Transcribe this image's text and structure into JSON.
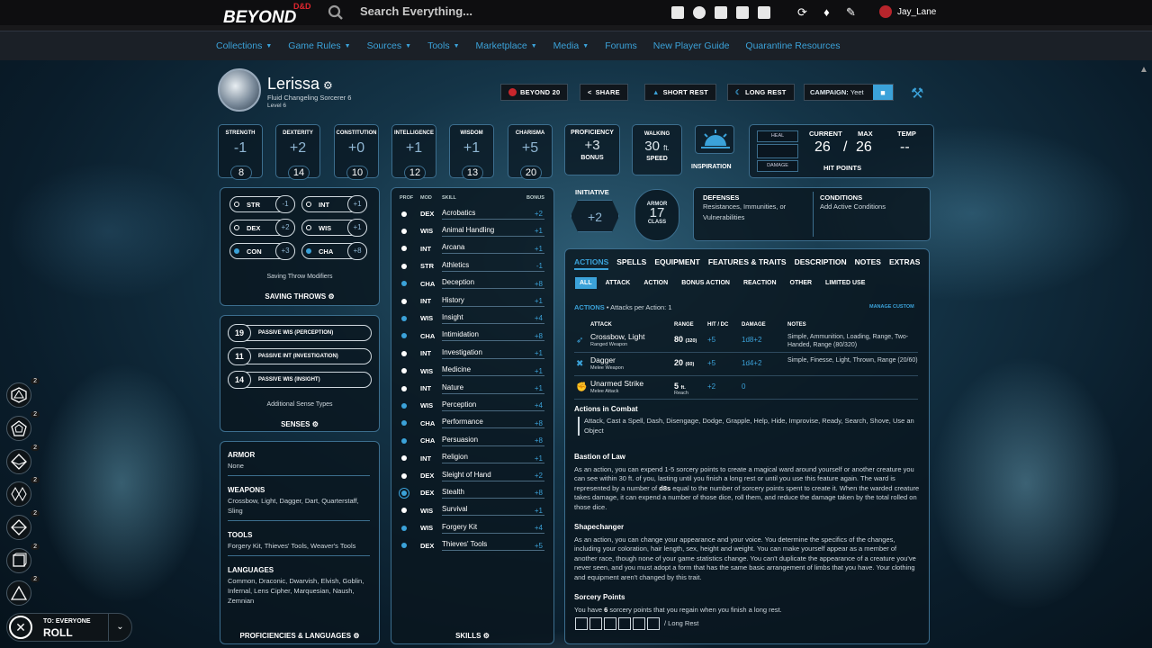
{
  "site": {
    "logo_top": "D&D",
    "logo_bottom": "BEYOND",
    "search_placeholder": "Search Everything...",
    "username": "Jay_Lane"
  },
  "nav": [
    {
      "label": "Collections",
      "dropdown": true
    },
    {
      "label": "Game Rules",
      "dropdown": true
    },
    {
      "label": "Sources",
      "dropdown": true
    },
    {
      "label": "Tools",
      "dropdown": true
    },
    {
      "label": "Marketplace",
      "dropdown": true
    },
    {
      "label": "Media",
      "dropdown": true
    },
    {
      "label": "Forums",
      "dropdown": false
    },
    {
      "label": "New Player Guide",
      "dropdown": false
    },
    {
      "label": "Quarantine Resources",
      "dropdown": false
    }
  ],
  "character": {
    "name": "Lerissa",
    "subtitle": "Fluid  Changeling  Sorcerer 6",
    "level": "Level 6"
  },
  "header_buttons": {
    "beyond20": "BEYOND 20",
    "share": "SHARE",
    "short_rest": "SHORT REST",
    "long_rest": "LONG REST",
    "campaign_label": "CAMPAIGN:",
    "campaign_name": "Yeet"
  },
  "abilities": [
    {
      "name": "STRENGTH",
      "mod": "-1",
      "score": "8"
    },
    {
      "name": "DEXTERITY",
      "mod": "+2",
      "score": "14"
    },
    {
      "name": "CONSTITUTION",
      "mod": "+0",
      "score": "10"
    },
    {
      "name": "INTELLIGENCE",
      "mod": "+1",
      "score": "12"
    },
    {
      "name": "WISDOM",
      "mod": "+1",
      "score": "13"
    },
    {
      "name": "CHARISMA",
      "mod": "+5",
      "score": "20"
    }
  ],
  "proficiency": {
    "label": "PROFICIENCY",
    "value": "+3",
    "sub": "BONUS"
  },
  "speed": {
    "label": "WALKING",
    "value": "30",
    "unit": "ft.",
    "sub": "SPEED"
  },
  "inspiration": {
    "label": "INSPIRATION"
  },
  "hit_points": {
    "heal": "HEAL",
    "damage": "DAMAGE",
    "current_label": "CURRENT",
    "max_label": "MAX",
    "temp_label": "TEMP",
    "current": "26",
    "sep": "/",
    "max": "26",
    "temp": "--",
    "label": "HIT POINTS"
  },
  "saving_throws": {
    "rows": [
      {
        "ab": "STR",
        "bonus": "-1",
        "prof": false
      },
      {
        "ab": "INT",
        "bonus": "+1",
        "prof": false
      },
      {
        "ab": "DEX",
        "bonus": "+2",
        "prof": false
      },
      {
        "ab": "WIS",
        "bonus": "+1",
        "prof": false
      },
      {
        "ab": "CON",
        "bonus": "+3",
        "prof": true
      },
      {
        "ab": "CHA",
        "bonus": "+8",
        "prof": true
      }
    ],
    "modifiers": "Saving Throw Modifiers",
    "title": "SAVING THROWS"
  },
  "senses": {
    "passives": [
      {
        "value": "19",
        "label": "PASSIVE WIS (PERCEPTION)"
      },
      {
        "value": "11",
        "label": "PASSIVE INT (INVESTIGATION)"
      },
      {
        "value": "14",
        "label": "PASSIVE WIS (INSIGHT)"
      }
    ],
    "additional": "Additional Sense Types",
    "title": "SENSES"
  },
  "proficiencies": {
    "armor_h": "ARMOR",
    "armor": "None",
    "weapons_h": "WEAPONS",
    "weapons": "Crossbow, Light, Dagger, Dart, Quarterstaff, Sling",
    "tools_h": "TOOLS",
    "tools": "Forgery Kit, Thieves' Tools, Weaver's Tools",
    "languages_h": "LANGUAGES",
    "languages": "Common, Draconic, Dwarvish, Elvish, Goblin, Infernal, Lens Cipher, Marquesian, Naush, Zemnian",
    "title": "PROFICIENCIES & LANGUAGES"
  },
  "skills": {
    "headers": {
      "prof": "PROF",
      "mod": "MOD",
      "skill": "SKILL",
      "bonus": "BONUS"
    },
    "title": "SKILLS",
    "rows": [
      {
        "mod": "DEX",
        "name": "Acrobatics",
        "bonus": "+2",
        "p": "n"
      },
      {
        "mod": "WIS",
        "name": "Animal Handling",
        "bonus": "+1",
        "p": "n"
      },
      {
        "mod": "INT",
        "name": "Arcana",
        "bonus": "+1",
        "p": "n"
      },
      {
        "mod": "STR",
        "name": "Athletics",
        "bonus": "-1",
        "p": "n"
      },
      {
        "mod": "CHA",
        "name": "Deception",
        "bonus": "+8",
        "p": "p"
      },
      {
        "mod": "INT",
        "name": "History",
        "bonus": "+1",
        "p": "n"
      },
      {
        "mod": "WIS",
        "name": "Insight",
        "bonus": "+4",
        "p": "p"
      },
      {
        "mod": "CHA",
        "name": "Intimidation",
        "bonus": "+8",
        "p": "p"
      },
      {
        "mod": "INT",
        "name": "Investigation",
        "bonus": "+1",
        "p": "n"
      },
      {
        "mod": "WIS",
        "name": "Medicine",
        "bonus": "+1",
        "p": "n"
      },
      {
        "mod": "INT",
        "name": "Nature",
        "bonus": "+1",
        "p": "n"
      },
      {
        "mod": "WIS",
        "name": "Perception",
        "bonus": "+4",
        "p": "p"
      },
      {
        "mod": "CHA",
        "name": "Performance",
        "bonus": "+8",
        "p": "p"
      },
      {
        "mod": "CHA",
        "name": "Persuasion",
        "bonus": "+8",
        "p": "p"
      },
      {
        "mod": "INT",
        "name": "Religion",
        "bonus": "+1",
        "p": "n"
      },
      {
        "mod": "DEX",
        "name": "Sleight of Hand",
        "bonus": "+2",
        "p": "n"
      },
      {
        "mod": "DEX",
        "name": "Stealth",
        "bonus": "+8",
        "p": "e"
      },
      {
        "mod": "WIS",
        "name": "Survival",
        "bonus": "+1",
        "p": "n"
      },
      {
        "mod": "WIS",
        "name": "Forgery Kit",
        "bonus": "+4",
        "p": "p"
      },
      {
        "mod": "DEX",
        "name": "Thieves' Tools",
        "bonus": "+5",
        "p": "p"
      }
    ]
  },
  "initiative": {
    "label": "INITIATIVE",
    "value": "+2"
  },
  "armor_class": {
    "top": "ARMOR",
    "value": "17",
    "bottom": "CLASS"
  },
  "defenses": {
    "title": "DEFENSES",
    "text": "Resistances, Immunities, or Vulnerabilities"
  },
  "conditions": {
    "title": "CONDITIONS",
    "text": "Add Active Conditions"
  },
  "tabs": [
    "ACTIONS",
    "SPELLS",
    "EQUIPMENT",
    "FEATURES & TRAITS",
    "DESCRIPTION",
    "NOTES",
    "EXTRAS"
  ],
  "subtabs": [
    "ALL",
    "ATTACK",
    "ACTION",
    "BONUS ACTION",
    "REACTION",
    "OTHER",
    "LIMITED USE"
  ],
  "actions": {
    "heading": "ACTIONS",
    "per_action": "• Attacks per Action: 1",
    "manage": "MANAGE CUSTOM",
    "cols": {
      "attack": "ATTACK",
      "range": "RANGE",
      "hit": "HIT / DC",
      "damage": "DAMAGE",
      "notes": "NOTES"
    },
    "attacks": [
      {
        "name": "Crossbow, Light",
        "type": "Ranged Weapon",
        "range": "80",
        "range_long": "(320)",
        "range_sub": "",
        "hit": "+5",
        "damage": "1d8+2",
        "notes": "Simple, Ammunition, Loading, Range, Two-Handed, Range (80/320)"
      },
      {
        "name": "Dagger",
        "type": "Melee Weapon",
        "range": "20",
        "range_long": "(60)",
        "range_sub": "",
        "hit": "+5",
        "damage": "1d4+2",
        "notes": "Simple, Finesse, Light, Thrown, Range (20/60)"
      },
      {
        "name": "Unarmed Strike",
        "type": "Melee Attack",
        "range": "5",
        "range_long": "ft.",
        "range_sub": "Reach",
        "hit": "+2",
        "damage": "0",
        "notes": ""
      }
    ],
    "combat_title": "Actions in Combat",
    "combat_text": "Attack, Cast a Spell, Dash, Disengage, Dodge, Grapple, Help, Hide, Improvise, Ready, Search, Shove, Use an Object",
    "bastion_title": "Bastion of Law",
    "bastion_text_a": "As an action, you can expend 1-5 sorcery points to create a magical ward around yourself or another creature you can see within 30 ft. of you, lasting until you finish a long rest or until you use this feature again. The ward is represented by a number of ",
    "bastion_bold": "d8s",
    "bastion_text_b": " equal to the number of sorcery points spent to create it. When the warded creature takes damage, it can expend a number of those dice, roll them, and reduce the damage taken by the total rolled on those dice.",
    "shape_title": "Shapechanger",
    "shape_text": "As an action, you can change your appearance and your voice. You determine the specifics of the changes, including your coloration, hair length, sex, height and weight. You can make yourself appear as a member of another race, though none of your game statistics change. You can't duplicate the appearance of a creature you've never seen, and you must adopt a form that has the same basic arrangement of limbs that you have. Your clothing and equipment aren't changed by this trait.",
    "sorc_title": "Sorcery Points",
    "sorc_a": "You have ",
    "sorc_n": "6",
    "sorc_b": " sorcery points that you regain when you finish a long rest.",
    "long_rest": "/ Long Rest"
  },
  "dice": [
    {
      "name": "d20",
      "count": "2"
    },
    {
      "name": "d12",
      "count": "2"
    },
    {
      "name": "d10",
      "count": "2"
    },
    {
      "name": "d100",
      "count": "2"
    },
    {
      "name": "d8",
      "count": "2"
    },
    {
      "name": "d6",
      "count": "2"
    },
    {
      "name": "d4",
      "count": "2"
    }
  ],
  "roll": {
    "to": "TO: EVERYONE",
    "label": "ROLL"
  }
}
